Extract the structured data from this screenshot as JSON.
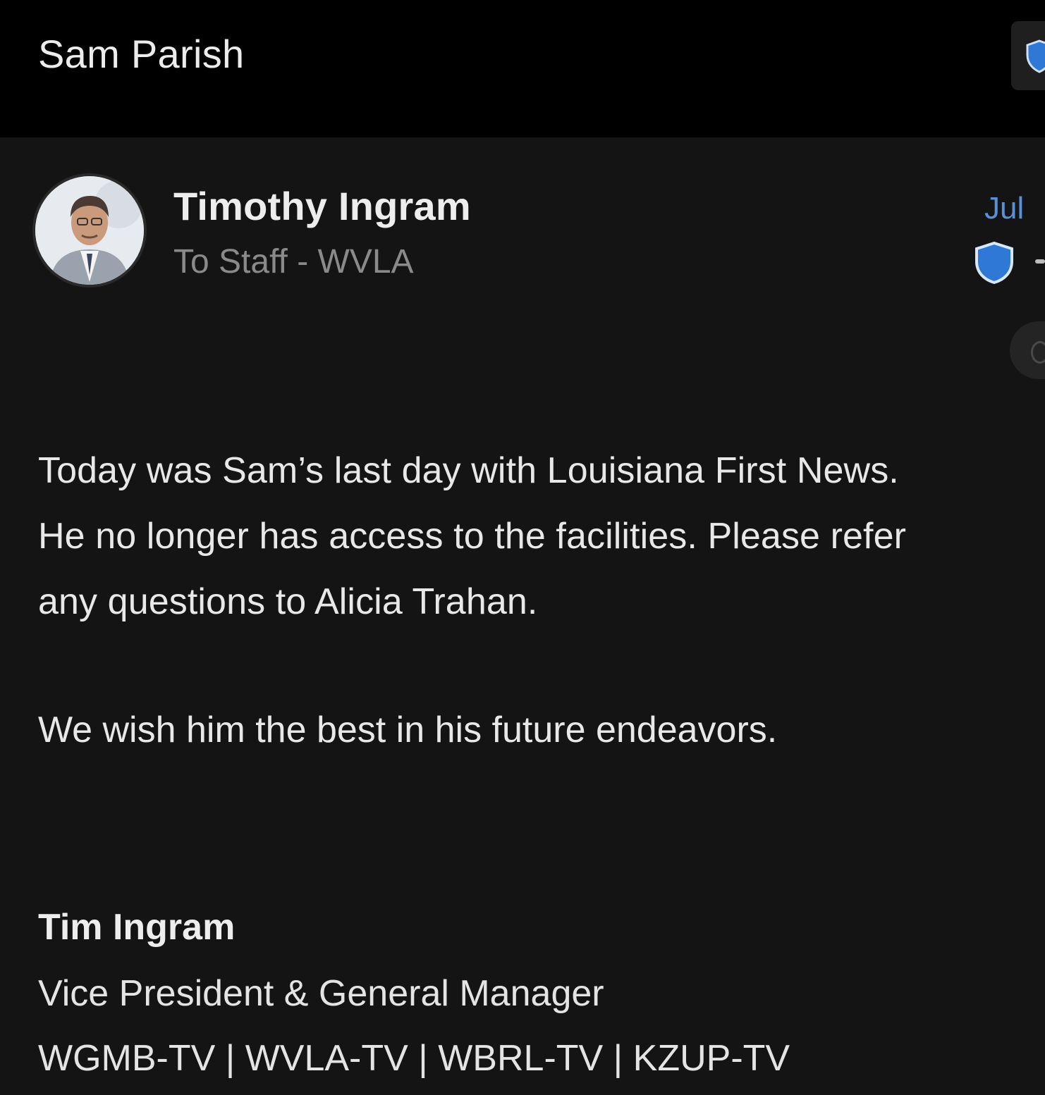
{
  "header": {
    "title": "Sam Parish",
    "action_icon": "shield-icon"
  },
  "message": {
    "sender_name": "Timothy Ingram",
    "recipients": "To Staff - WVLA",
    "date": "Jul",
    "security_icon": "shield-icon",
    "body_lines": [
      "Today was Sam’s last day with Louisiana First News.",
      "He no longer has access to the facilities. Please refer",
      "any questions to Alicia Trahan."
    ],
    "closing": "We wish him the best in his future endeavors.",
    "signature": {
      "name": "Tim Ingram",
      "title": "Vice President & General Manager",
      "stations": "WGMB-TV | WVLA-TV | WBRL-TV | KZUP-TV"
    }
  },
  "colors": {
    "background": "#141414",
    "header_background": "#000000",
    "accent_blue": "#3b7fd9",
    "muted_text": "#8a8a8a"
  }
}
